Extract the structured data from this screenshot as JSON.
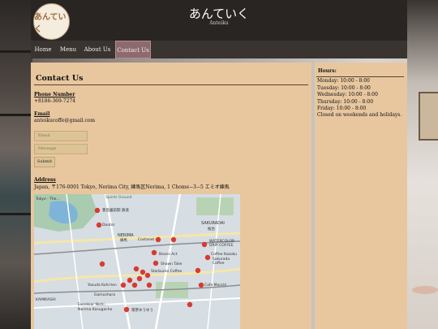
{
  "header": {
    "logo_text": "あんていく",
    "title": "あんていく",
    "subtitle": "Anteiku"
  },
  "nav": {
    "items": [
      {
        "label": "Home"
      },
      {
        "label": "Menu"
      },
      {
        "label": "About Us"
      },
      {
        "label": "Contact Us"
      }
    ],
    "active_index": 3
  },
  "contact": {
    "heading": "Contact Us",
    "phone_label": "Phone Number",
    "phone": "+8186-369-7274",
    "email_label": "Email",
    "email": "anteikucoffe@gmail.com",
    "form": {
      "email_placeholder": "Email",
      "message_placeholder": "Message",
      "submit_label": "Submit"
    },
    "address_label": "Address",
    "address": "Japan, 〒176-0001 Tokyo, Nerima City, 練馬区Nerima, 1 Chome−3−5 エミオ練馬"
  },
  "map": {
    "places": [
      "Tokyo - The...",
      "Sports Ground",
      "豊島園前期 鉄道",
      "Doutor",
      "NERIMA",
      "練馬",
      "Costanet",
      "SAKURADAI",
      "桜台",
      "WATERCOLOR DRIP COFFEE",
      "Coffee Kazoku",
      "Sakurada Coffee",
      "Beans Act",
      "Shawn Take",
      "Starbucks Coffee",
      "Yasuda Kohi-ten",
      "Gamushara",
      "Cafe Mocchi",
      "KAMIKASHI",
      "Excelsior Nishi...",
      "Nerima Kasugacho",
      "喫茶ゆうゆう"
    ]
  },
  "hours": {
    "heading": "Hours:",
    "lines": [
      "Monday: 10:00 - 8:00",
      "Tuesday: 10:00 - 8:00",
      "Wednesday: 10:00 - 8:00",
      "Thursday: 10:00 - 8:00",
      "Friday: 10:00 - 8:00"
    ],
    "closed_note": "Closed on weekends and holidays."
  },
  "colors": {
    "header_bg": "#292523",
    "nav_bg": "#3a3431",
    "nav_active": "#8d6a6e",
    "content_bg": "#e8c79f",
    "map_pin": "#d93a2f"
  }
}
